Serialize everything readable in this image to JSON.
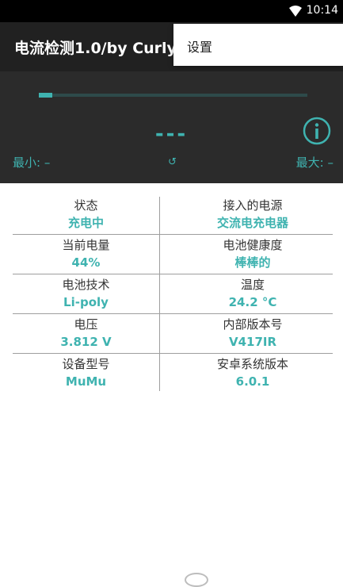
{
  "status_bar": {
    "time": "10:14",
    "icons": [
      "wifi-icon"
    ]
  },
  "app_bar": {
    "title": "电流检测1.0/by Curly"
  },
  "menu": {
    "items": [
      {
        "label": "设置"
      }
    ]
  },
  "monitor": {
    "progress_fraction": 0.05,
    "current_reading": "---",
    "min_label": "最小: –",
    "max_label": "最大: –",
    "reset_symbol": "↺",
    "accent_color": "#3fb3b0"
  },
  "info_table": {
    "rows": [
      {
        "left": {
          "label": "状态",
          "value": "充电中"
        },
        "right": {
          "label": "接入的电源",
          "value": "交流电充电器"
        }
      },
      {
        "left": {
          "label": "当前电量",
          "value": "44%"
        },
        "right": {
          "label": "电池健康度",
          "value": "棒棒的"
        }
      },
      {
        "left": {
          "label": "电池技术",
          "value": "Li-poly"
        },
        "right": {
          "label": "温度",
          "value": "24.2 °C"
        }
      },
      {
        "left": {
          "label": "电压",
          "value": "3.812 V"
        },
        "right": {
          "label": "内部版本号",
          "value": "V417IR"
        }
      },
      {
        "left": {
          "label": "设备型号",
          "value": "MuMu"
        },
        "right": {
          "label": "安卓系统版本",
          "value": "6.0.1"
        }
      }
    ]
  }
}
